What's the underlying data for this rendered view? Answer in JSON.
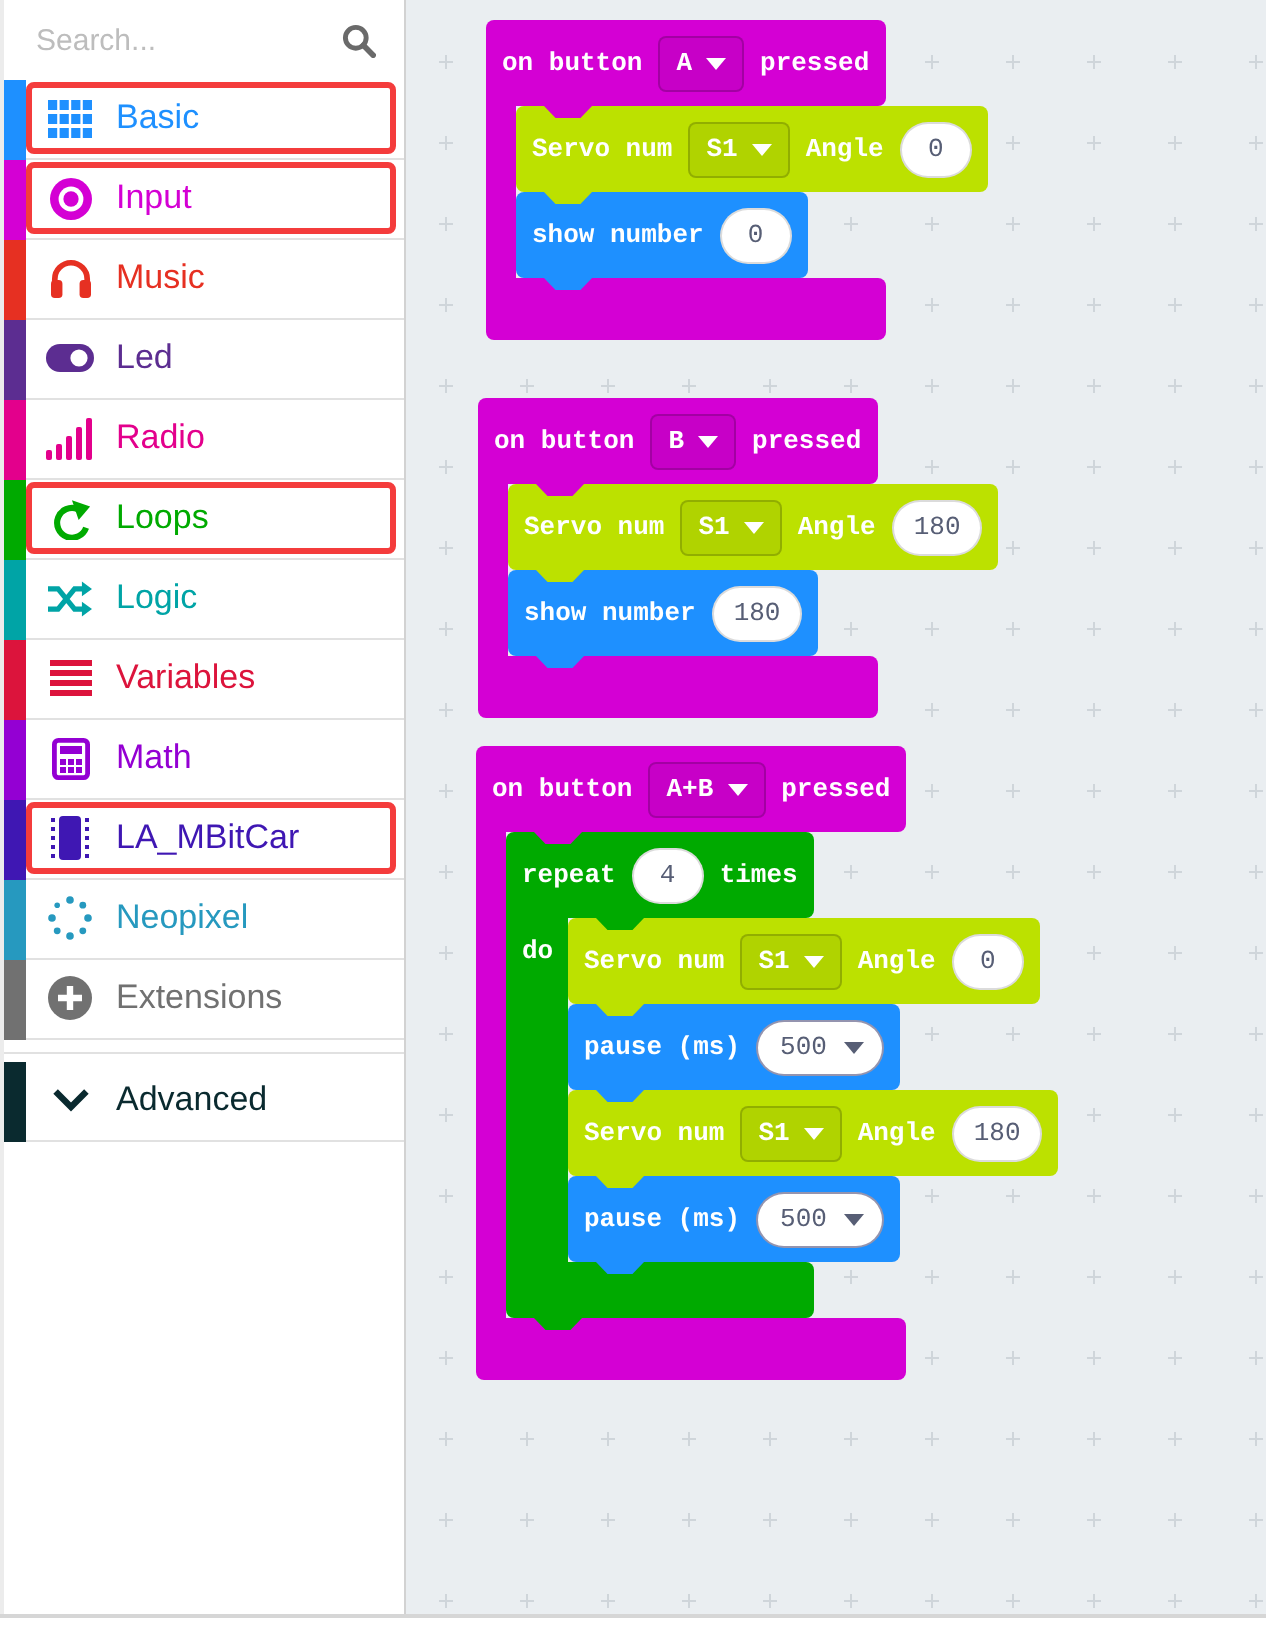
{
  "sidebar": {
    "search": {
      "placeholder": "Search..."
    },
    "categories": [
      {
        "label": "Basic",
        "kind": "grid",
        "color": "#1e90ff",
        "highlighted": true
      },
      {
        "label": "Input",
        "kind": "target",
        "color": "#d400d4",
        "highlighted": true
      },
      {
        "label": "Music",
        "kind": "headphones",
        "color": "#e63022",
        "highlighted": false
      },
      {
        "label": "Led",
        "kind": "toggle",
        "color": "#5c2d91",
        "highlighted": false
      },
      {
        "label": "Radio",
        "kind": "signal",
        "color": "#e3008c",
        "highlighted": false
      },
      {
        "label": "Loops",
        "kind": "loop",
        "color": "#00aa00",
        "highlighted": true
      },
      {
        "label": "Logic",
        "kind": "shuffle",
        "color": "#00a4a6",
        "highlighted": false
      },
      {
        "label": "Variables",
        "kind": "lines",
        "color": "#dc143c",
        "highlighted": false
      },
      {
        "label": "Math",
        "kind": "calculator",
        "color": "#9400d3",
        "highlighted": false
      },
      {
        "label": "LA_MBitCar",
        "kind": "chip",
        "color": "#3f17b3",
        "highlighted": true
      },
      {
        "label": "Neopixel",
        "kind": "dots",
        "color": "#2699bf",
        "highlighted": false
      },
      {
        "label": "Extensions",
        "kind": "plus",
        "color": "#717171",
        "highlighted": false
      }
    ],
    "advanced": {
      "label": "Advanced",
      "color": "#0a2a2f"
    }
  },
  "workspace": {
    "scripts": [
      {
        "kind": "event",
        "color": "#d400d4",
        "fields": [
          {
            "kind": "label",
            "text": "on button"
          },
          {
            "kind": "dropdown",
            "text": "A"
          },
          {
            "kind": "label",
            "text": "pressed"
          }
        ],
        "body": [
          {
            "kind": "statement",
            "color": "#bce100",
            "fields": [
              {
                "kind": "label",
                "text": "Servo num"
              },
              {
                "kind": "dropdown",
                "text": "S1"
              },
              {
                "kind": "label",
                "text": "Angle"
              },
              {
                "kind": "number",
                "text": "0"
              }
            ]
          },
          {
            "kind": "statement",
            "color": "#1e90ff",
            "fields": [
              {
                "kind": "label",
                "text": "show number"
              },
              {
                "kind": "number",
                "text": "0"
              }
            ]
          }
        ]
      },
      {
        "kind": "event",
        "color": "#d400d4",
        "fields": [
          {
            "kind": "label",
            "text": "on button"
          },
          {
            "kind": "dropdown",
            "text": "B"
          },
          {
            "kind": "label",
            "text": "pressed"
          }
        ],
        "body": [
          {
            "kind": "statement",
            "color": "#bce100",
            "fields": [
              {
                "kind": "label",
                "text": "Servo num"
              },
              {
                "kind": "dropdown",
                "text": "S1"
              },
              {
                "kind": "label",
                "text": "Angle"
              },
              {
                "kind": "number",
                "text": "180"
              }
            ]
          },
          {
            "kind": "statement",
            "color": "#1e90ff",
            "fields": [
              {
                "kind": "label",
                "text": "show number"
              },
              {
                "kind": "number",
                "text": "180"
              }
            ]
          }
        ]
      },
      {
        "kind": "event",
        "color": "#d400d4",
        "fields": [
          {
            "kind": "label",
            "text": "on button"
          },
          {
            "kind": "dropdown",
            "text": "A+B"
          },
          {
            "kind": "label",
            "text": "pressed"
          }
        ],
        "body": [
          {
            "kind": "loop",
            "color": "#00aa00",
            "fields": [
              {
                "kind": "label",
                "text": "repeat"
              },
              {
                "kind": "number",
                "text": "4"
              },
              {
                "kind": "label",
                "text": "times"
              }
            ],
            "do_label": "do",
            "body": [
              {
                "kind": "statement",
                "color": "#bce100",
                "fields": [
                  {
                    "kind": "label",
                    "text": "Servo num"
                  },
                  {
                    "kind": "dropdown",
                    "text": "S1"
                  },
                  {
                    "kind": "label",
                    "text": "Angle"
                  },
                  {
                    "kind": "number",
                    "text": "0"
                  }
                ]
              },
              {
                "kind": "statement",
                "color": "#1e90ff",
                "fields": [
                  {
                    "kind": "label",
                    "text": "pause (ms)"
                  },
                  {
                    "kind": "number_dropdown",
                    "text": "500"
                  }
                ]
              },
              {
                "kind": "statement",
                "color": "#bce100",
                "fields": [
                  {
                    "kind": "label",
                    "text": "Servo num"
                  },
                  {
                    "kind": "dropdown",
                    "text": "S1"
                  },
                  {
                    "kind": "label",
                    "text": "Angle"
                  },
                  {
                    "kind": "number",
                    "text": "180"
                  }
                ]
              },
              {
                "kind": "statement",
                "color": "#1e90ff",
                "fields": [
                  {
                    "kind": "label",
                    "text": "pause (ms)"
                  },
                  {
                    "kind": "number_dropdown",
                    "text": "500"
                  }
                ]
              }
            ]
          }
        ]
      }
    ]
  }
}
